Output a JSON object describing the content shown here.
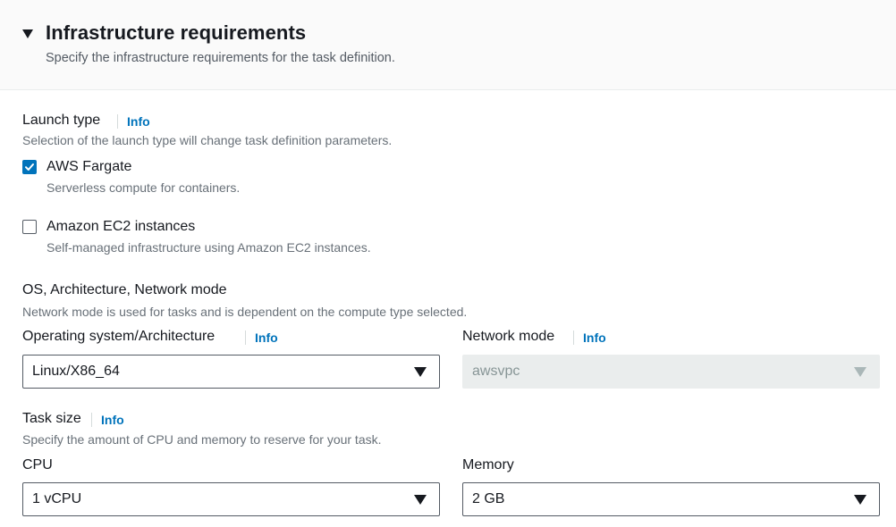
{
  "section": {
    "title": "Infrastructure requirements",
    "description": "Specify the infrastructure requirements for the task definition."
  },
  "launch_type": {
    "label": "Launch type",
    "info": "Info",
    "description": "Selection of the launch type will change task definition parameters.",
    "options": [
      {
        "label": "AWS Fargate",
        "description": "Serverless compute for containers.",
        "checked": true
      },
      {
        "label": "Amazon EC2 instances",
        "description": "Self-managed infrastructure using Amazon EC2 instances.",
        "checked": false
      }
    ]
  },
  "os_arch_network": {
    "label": "OS, Architecture, Network mode",
    "description": "Network mode is used for tasks and is dependent on the compute type selected.",
    "os_arch": {
      "label": "Operating system/Architecture",
      "info": "Info",
      "value": "Linux/X86_64"
    },
    "network_mode": {
      "label": "Network mode",
      "info": "Info",
      "value": "awsvpc",
      "disabled": true
    }
  },
  "task_size": {
    "label": "Task size",
    "info": "Info",
    "description": "Specify the amount of CPU and memory to reserve for your task.",
    "cpu": {
      "label": "CPU",
      "value": "1 vCPU"
    },
    "memory": {
      "label": "Memory",
      "value": "2 GB"
    }
  },
  "colors": {
    "accent": "#0073bb",
    "header_bg": "#fafafa",
    "text": "#16191f",
    "muted": "#687078",
    "disabled_bg": "#eaeded"
  }
}
